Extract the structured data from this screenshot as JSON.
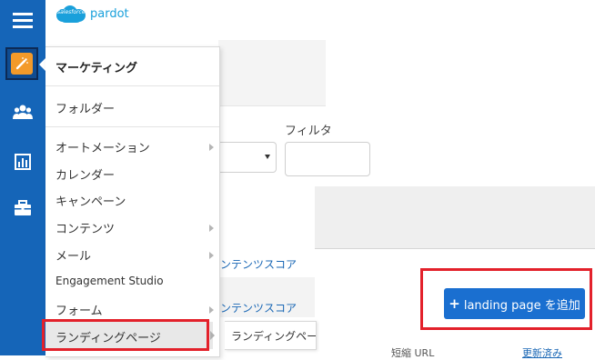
{
  "header": {
    "logo_brand": "salesforce",
    "logo_product": "pardot"
  },
  "rail": {
    "items": [
      {
        "icon": "hamburger-menu-icon"
      },
      {
        "icon": "marketing-wand-icon",
        "active": true
      },
      {
        "icon": "users-icon"
      },
      {
        "icon": "reports-chart-icon"
      },
      {
        "icon": "briefcase-icon"
      }
    ]
  },
  "menu": {
    "title": "マーケティング",
    "items": [
      {
        "label": "フォルダー",
        "has_submenu": false
      },
      {
        "label": "オートメーション",
        "has_submenu": true
      },
      {
        "label": "カレンダー",
        "has_submenu": false
      },
      {
        "label": "キャンペーン",
        "has_submenu": false
      },
      {
        "label": "コンテンツ",
        "has_submenu": true
      },
      {
        "label": "メール",
        "has_submenu": true
      },
      {
        "label": "Engagement Studio",
        "has_submenu": false
      },
      {
        "label": "フォーム",
        "has_submenu": true
      },
      {
        "label": "ランディングページ",
        "has_submenu": true,
        "highlighted": true
      }
    ],
    "submenu_item": "ランディングペー"
  },
  "background": {
    "filter_label": "フィルタ",
    "link_1": "ンテンツスコア",
    "link_2": "ンテンツスコア",
    "footer_text": "短縮 URL",
    "footer_link": "更新済み"
  },
  "add_button": {
    "label": "landing page を追加"
  },
  "colors": {
    "rail": "#1565b8",
    "accent": "#f39a2a",
    "button": "#1a6fd0",
    "highlight": "#e3212b"
  }
}
